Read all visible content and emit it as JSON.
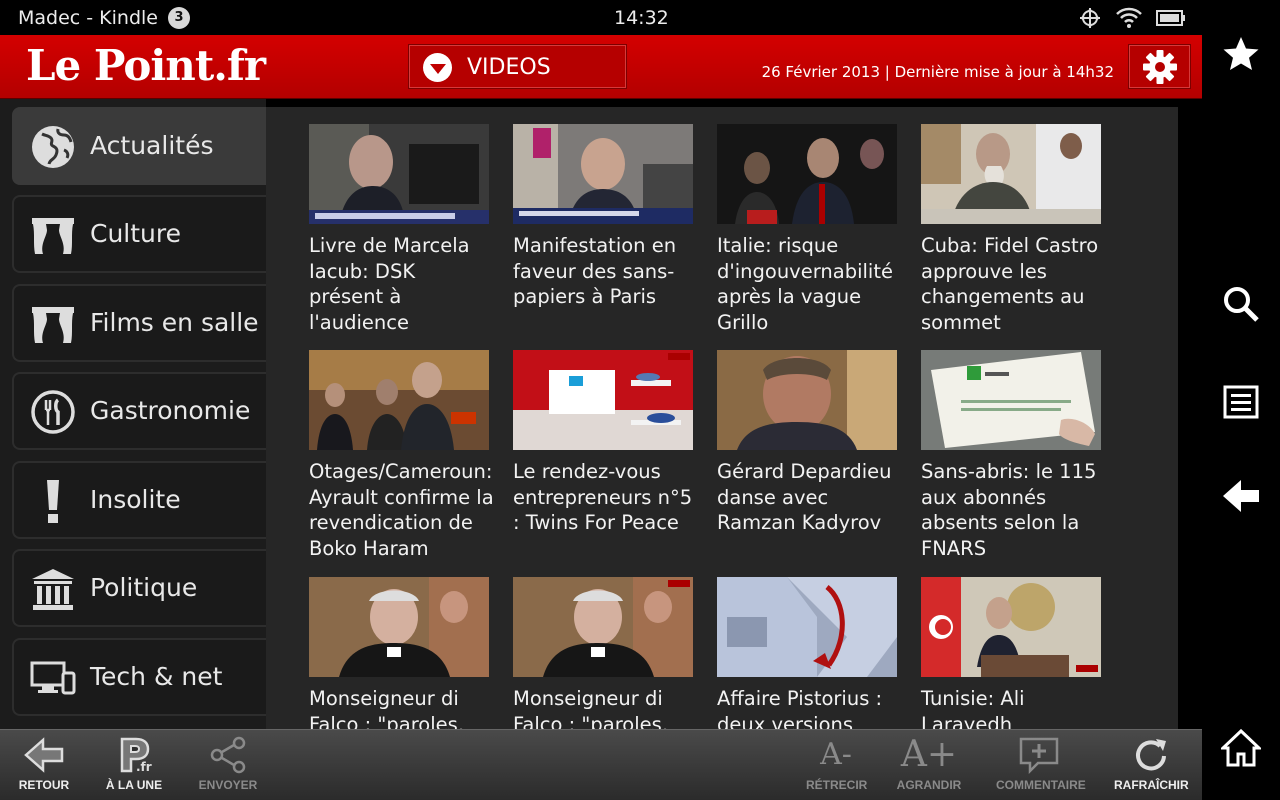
{
  "status": {
    "app_title": "Madec - Kindle",
    "notification_count": "3",
    "time": "14:32"
  },
  "header": {
    "logo": "Le Point.fr",
    "section": "VIDEOS",
    "date_text": "26 Février 2013 | Dernière mise à jour à 14h32"
  },
  "sidebar": {
    "items": [
      {
        "label": "Actualités",
        "icon": "globe-icon",
        "active": true
      },
      {
        "label": "Culture",
        "icon": "theater-curtain-icon"
      },
      {
        "label": "Films en salle",
        "icon": "theater-curtain-icon"
      },
      {
        "label": "Gastronomie",
        "icon": "fork-knife-icon"
      },
      {
        "label": "Insolite",
        "icon": "exclamation-icon"
      },
      {
        "label": "Politique",
        "icon": "building-icon"
      },
      {
        "label": "Tech & net",
        "icon": "devices-icon"
      }
    ]
  },
  "videos": [
    {
      "title": "Livre de Marcela Iacub: DSK présent à l'audience"
    },
    {
      "title": "Manifestation en faveur des sans-papiers à Paris"
    },
    {
      "title": "Italie: risque d'ingouvernabilité après la vague Grillo"
    },
    {
      "title": "Cuba: Fidel Castro approuve les changements au sommet"
    },
    {
      "title": "Otages/Cameroun: Ayrault confirme la revendication de Boko Haram"
    },
    {
      "title": "Le rendez-vous entrepreneurs n°5 : Twins For Peace"
    },
    {
      "title": "Gérard Depardieu danse avec Ramzan Kadyrov"
    },
    {
      "title": "Sans-abris: le 115 aux abonnés absents selon la FNARS"
    },
    {
      "title": "Monseigneur di Falco : \"paroles,"
    },
    {
      "title": "Monseigneur di Falco : \"paroles,"
    },
    {
      "title": "Affaire Pistorius : deux versions"
    },
    {
      "title": "Tunisie: Ali Larayedh"
    }
  ],
  "toolbar": {
    "back": "RETOUR",
    "front_page": "À LA UNE",
    "send": "ENVOYER",
    "shrink": "RÉTRECIR",
    "enlarge": "AGRANDIR",
    "comment": "COMMENTAIRE",
    "refresh": "RAFRAÎCHIR",
    "shrink_glyph": "A-",
    "enlarge_glyph": "A+"
  },
  "colors": {
    "brand_red": "#c00000",
    "content_bg": "#262626",
    "sidebar_active": "#3a3a3a"
  }
}
